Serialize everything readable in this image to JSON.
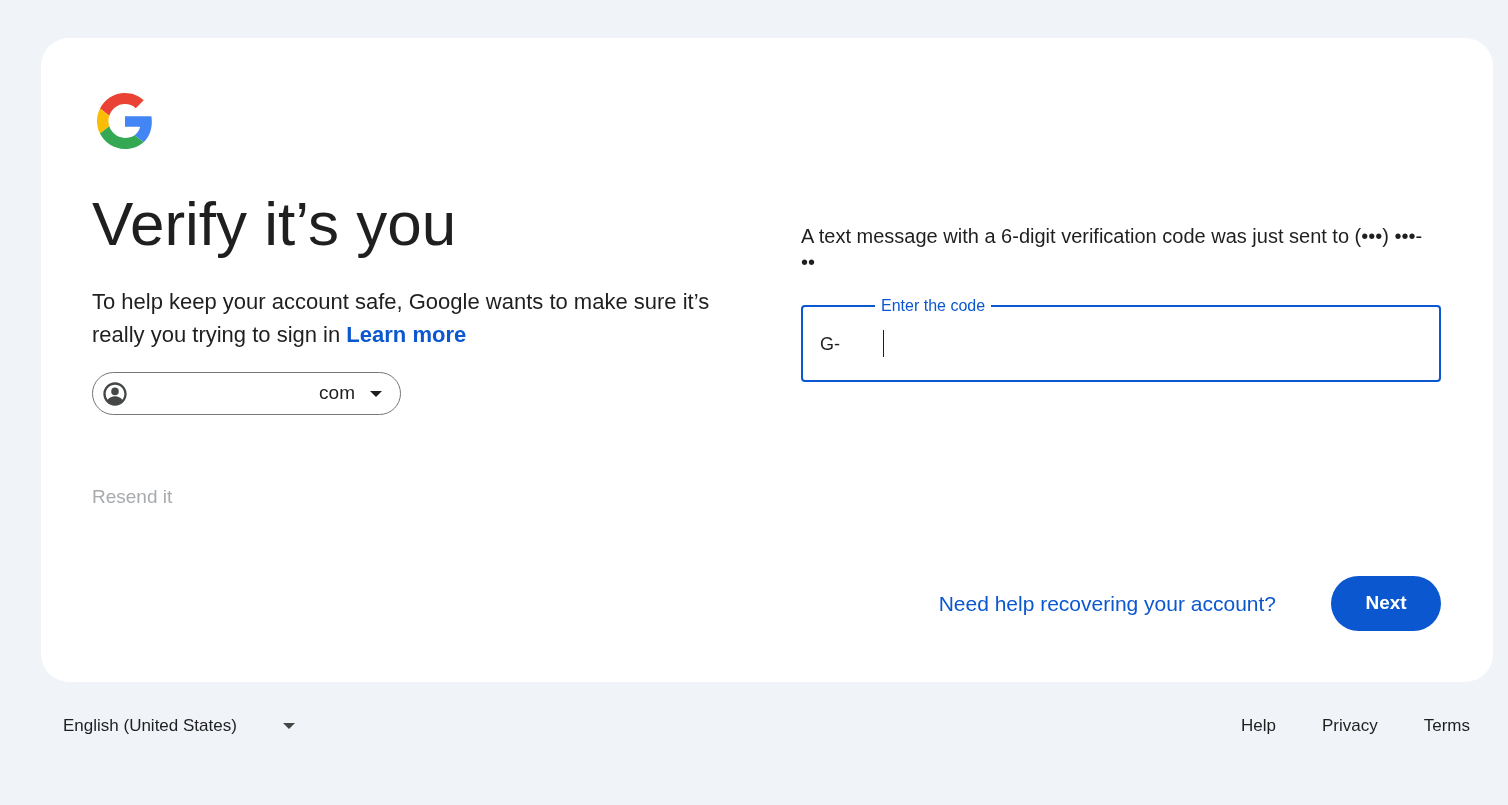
{
  "heading": "Verify it’s you",
  "description": {
    "text": "To help keep your account safe, Google wants to make sure it’s really you trying to sign in",
    "link": "Learn more"
  },
  "account_chip": {
    "text": "com"
  },
  "resend": {
    "label": "Resend it",
    "disabled": true
  },
  "message": "A text message with a 6-digit verification code was just sent to (•••) •••-••",
  "code_field": {
    "label": "Enter the code",
    "prefix": "G-",
    "focused": true
  },
  "help_link": "Need help recovering your account?",
  "next_button": "Next",
  "footer": {
    "language": "English (United States)",
    "links": [
      "Help",
      "Privacy",
      "Terms"
    ]
  }
}
